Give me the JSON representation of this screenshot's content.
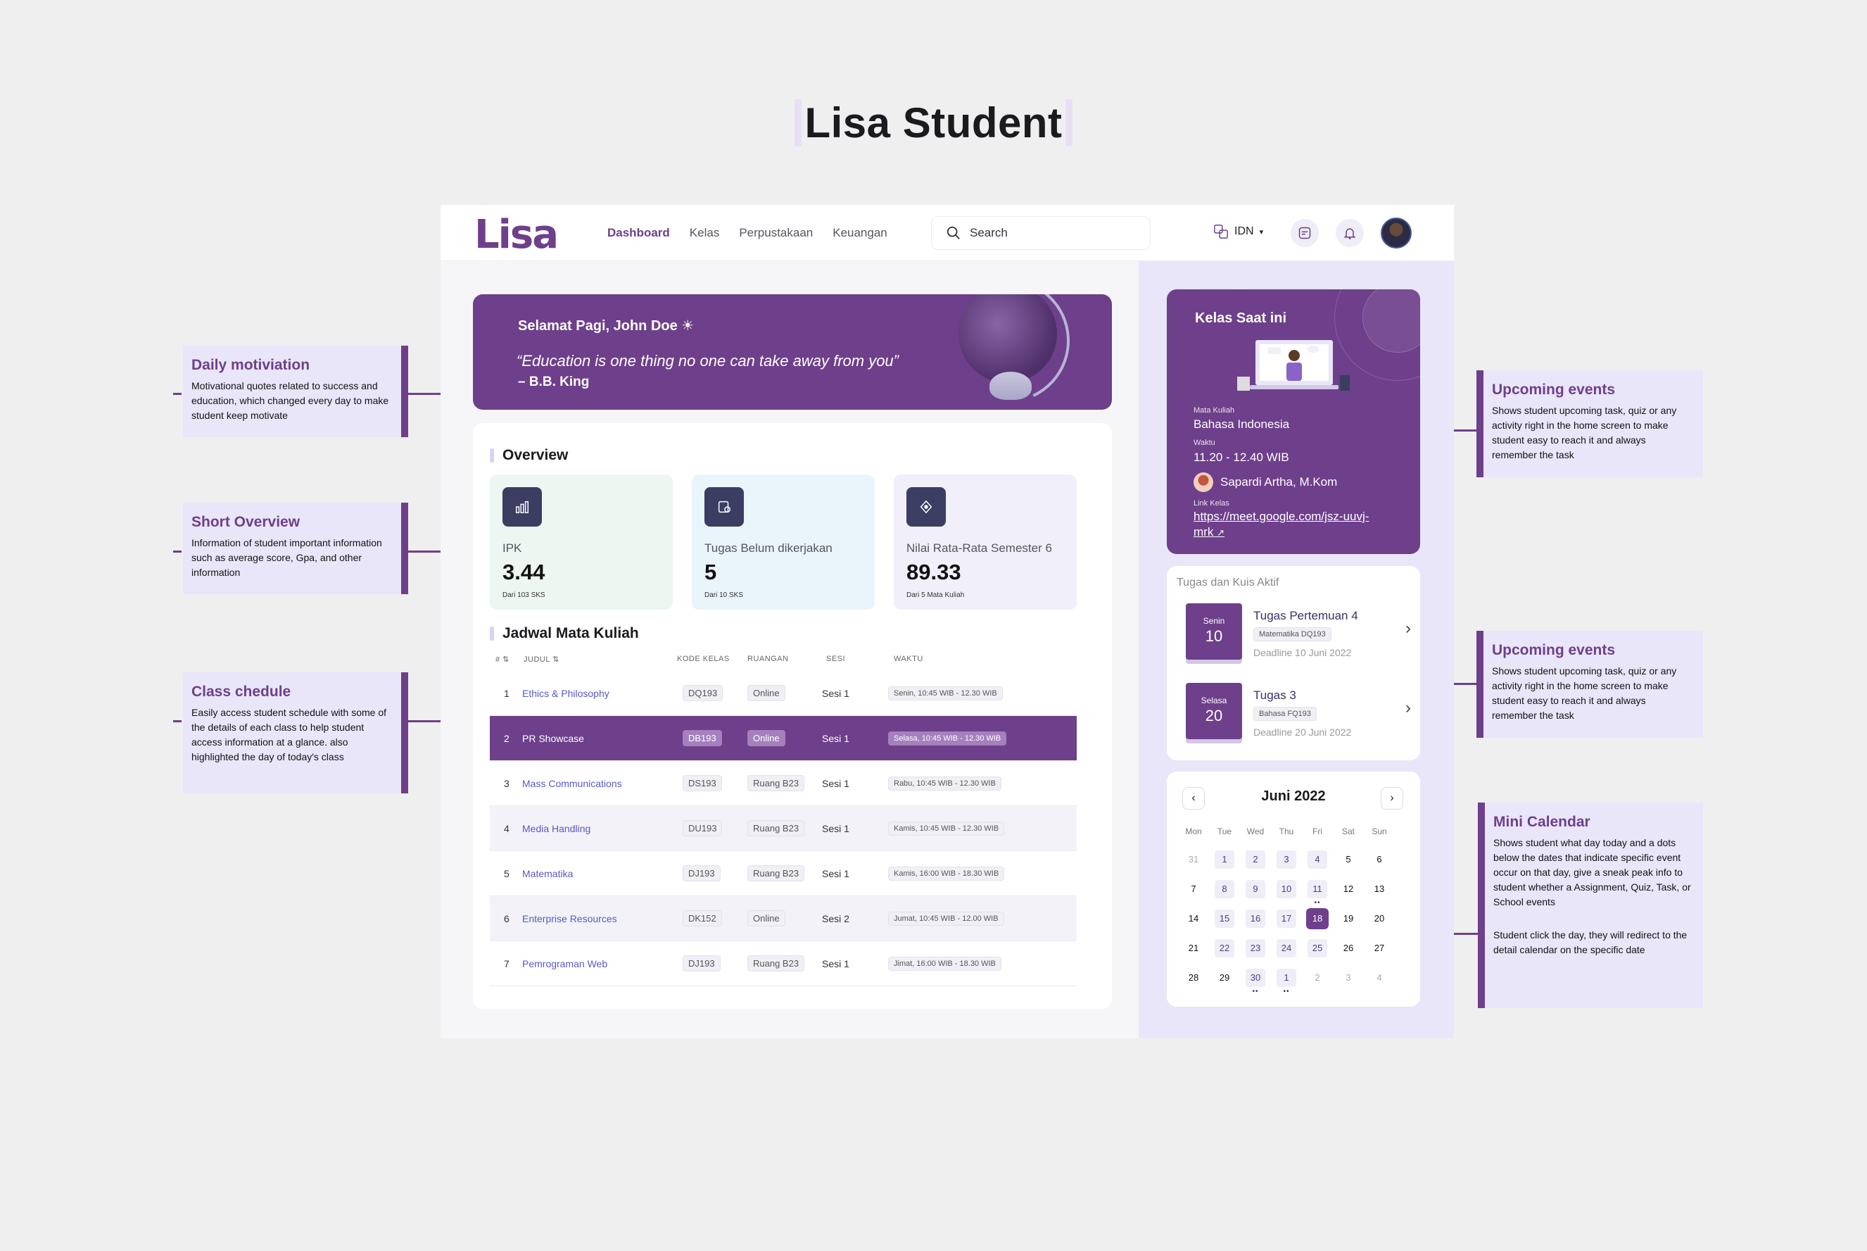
{
  "page": {
    "title": "Lisa Student"
  },
  "annotations": {
    "left": [
      {
        "title": "Daily motiviation",
        "text": "Motivational quotes related to success and education, which changed every day to make student keep motivate"
      },
      {
        "title": "Short Overview",
        "text": "Information of student important information such as average score, Gpa, and other information"
      },
      {
        "title": "Class chedule",
        "text": "Easily access student schedule with some of the details of each class to help student access information at a glance. also highlighted the day of today's class"
      }
    ],
    "right": [
      {
        "title": "Upcoming events",
        "text": "Shows student upcoming task, quiz or any activity right in the home screen to make student easy to reach it and always remember the task"
      },
      {
        "title": "Upcoming events",
        "text": "Shows student upcoming task, quiz or any activity right in the home screen to make student easy to reach it and always remember the task"
      },
      {
        "title": "Mini Calendar",
        "text": "Shows  student what day today and a dots below the dates that indicate specific event occur on that day, give a sneak peak info to student whether a Assignment, Quiz, Task, or School events",
        "text2": "Student click the day, they will redirect to the detail calendar on the specific date"
      }
    ]
  },
  "app": {
    "logo": "Lisa",
    "nav": [
      "Dashboard",
      "Kelas",
      "Perpustakaan",
      "Keuangan"
    ],
    "search_placeholder": "Search",
    "language": "IDN",
    "icons": {
      "search": "search-icon",
      "language": "translate-icon",
      "chat": "chat-icon",
      "notifications": "bell-icon"
    },
    "colors": {
      "primary": "#6e3f8a",
      "accent": "#e9e6fa",
      "link": "#5858c8"
    }
  },
  "banner": {
    "greeting": "Selamat Pagi, John Doe ☀",
    "quote": "“Education is one thing no one can take away from you”",
    "author": "– B.B. King"
  },
  "overview": {
    "title": "Overview",
    "stats": [
      {
        "label": "IPK",
        "value": "3.44",
        "sub": "Dari 103 SKS",
        "icon": "bar-chart-icon"
      },
      {
        "label": "Tugas Belum dikerjakan",
        "value": "5",
        "sub": "Dari 10 SKS",
        "icon": "task-icon"
      },
      {
        "label": "Nilai Rata-Rata Semester 6",
        "value": "89.33",
        "sub": "Dari 5 Mata Kuliah",
        "icon": "score-icon"
      }
    ]
  },
  "schedule": {
    "title": "Jadwal Mata Kuliah",
    "headers": [
      "#",
      "JUDUL",
      "KODE KELAS",
      "RUANGAN",
      "SESI",
      "WAKTU"
    ],
    "rows": [
      {
        "no": "1",
        "judul": "Ethics & Philosophy",
        "kode": "DQ193",
        "ruang": "Online",
        "sesi": "Sesi 1",
        "waktu": "Senin, 10:45 WIB - 12.30 WIB"
      },
      {
        "no": "2",
        "judul": "PR Showcase",
        "kode": "DB193",
        "ruang": "Online",
        "sesi": "Sesi 1",
        "waktu": "Selasa, 10:45 WIB - 12.30 WIB"
      },
      {
        "no": "3",
        "judul": "Mass Communications",
        "kode": "DS193",
        "ruang": "Ruang B23",
        "sesi": "Sesi 1",
        "waktu": "Rabu, 10:45 WIB - 12.30 WIB"
      },
      {
        "no": "4",
        "judul": "Media Handling",
        "kode": "DU193",
        "ruang": "Ruang B23",
        "sesi": "Sesi 1",
        "waktu": "Kamis, 10:45 WIB - 12.30 WIB"
      },
      {
        "no": "5",
        "judul": "Matematika",
        "kode": "DJ193",
        "ruang": "Ruang B23",
        "sesi": "Sesi 1",
        "waktu": "Kamis, 16:00 WIB - 18.30 WIB"
      },
      {
        "no": "6",
        "judul": "Enterprise Resources",
        "kode": "DK152",
        "ruang": "Online",
        "sesi": "Sesi 2",
        "waktu": "Jumat, 10:45 WIB - 12.00 WIB"
      },
      {
        "no": "7",
        "judul": "Pemrograman Web",
        "kode": "DJ193",
        "ruang": "Ruang B23",
        "sesi": "Sesi 1",
        "waktu": "Jimat, 16:00 WIB - 18.30 WIB"
      }
    ]
  },
  "kelas": {
    "title": "Kelas Saat ini",
    "mk_label": "Mata Kuliah",
    "mk": "Bahasa Indonesia",
    "waktu_label": "Waktu",
    "waktu": "11.20 - 12.40 WIB",
    "dosen": "Sapardi Artha, M.Kom",
    "link_label": "Link Kelas",
    "link": "https://meet.google.com/jsz-uuvj-mrk"
  },
  "tugas": {
    "title": "Tugas dan Kuis Aktif",
    "items": [
      {
        "day": "Senin",
        "date": "10",
        "title": "Tugas Pertemuan 4",
        "tag": "Matematika DQ193",
        "deadline": "Deadline 10 Juni 2022"
      },
      {
        "day": "Selasa",
        "date": "20",
        "title": "Tugas 3",
        "tag": "Bahasa FQ193",
        "deadline": "Deadline 20 Juni 2022"
      }
    ]
  },
  "calendar": {
    "month": "Juni 2022",
    "dow": [
      "Mon",
      "Tue",
      "Wed",
      "Thu",
      "Fri",
      "Sat",
      "Sun"
    ],
    "today": "18",
    "days": [
      {
        "d": "31",
        "muted": true,
        "ev": false
      },
      {
        "d": "1",
        "ev": true
      },
      {
        "d": "2",
        "ev": true
      },
      {
        "d": "3",
        "ev": true
      },
      {
        "d": "4",
        "ev": true
      },
      {
        "d": "5"
      },
      {
        "d": "6"
      },
      {
        "d": "7"
      },
      {
        "d": "8",
        "ev": true
      },
      {
        "d": "9",
        "ev": true
      },
      {
        "d": "10",
        "ev": true
      },
      {
        "d": "11",
        "ev": true,
        "dots": true
      },
      {
        "d": "12"
      },
      {
        "d": "13"
      },
      {
        "d": "14"
      },
      {
        "d": "15",
        "ev": true
      },
      {
        "d": "16",
        "ev": true
      },
      {
        "d": "17",
        "ev": true
      },
      {
        "d": "18",
        "today": true
      },
      {
        "d": "19"
      },
      {
        "d": "20"
      },
      {
        "d": "21"
      },
      {
        "d": "22",
        "ev": true
      },
      {
        "d": "23",
        "ev": true
      },
      {
        "d": "24",
        "ev": true
      },
      {
        "d": "25",
        "ev": true
      },
      {
        "d": "26"
      },
      {
        "d": "27"
      },
      {
        "d": "28"
      },
      {
        "d": "29"
      },
      {
        "d": "30",
        "ev": true,
        "dots": true
      },
      {
        "d": "1",
        "ev": true,
        "dots": true
      },
      {
        "d": "2",
        "muted": true
      },
      {
        "d": "3",
        "muted": true
      },
      {
        "d": "4",
        "muted": true
      }
    ]
  }
}
